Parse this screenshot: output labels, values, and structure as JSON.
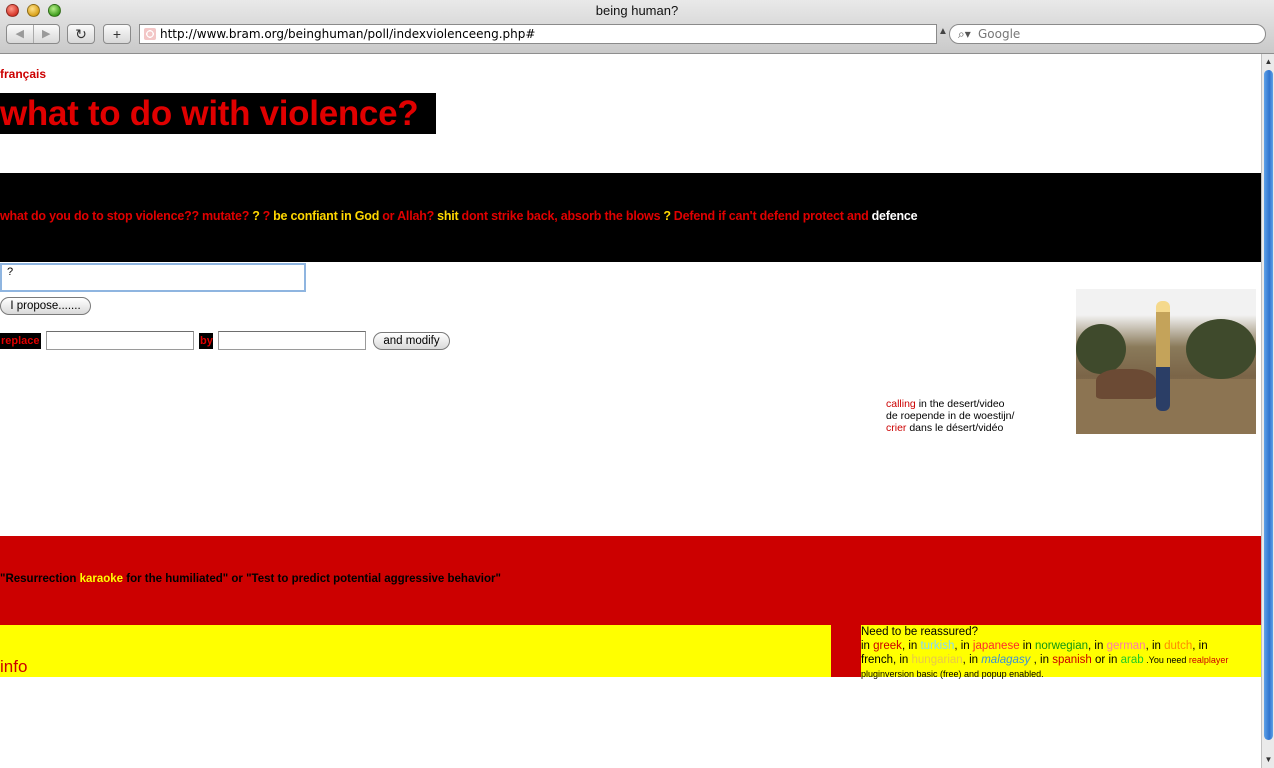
{
  "browser": {
    "title": "being human?",
    "url": "http://www.bram.org/beinghuman/poll/indexviolenceeng.php#",
    "search_placeholder": "Google"
  },
  "page": {
    "language_link": "français",
    "headline": "what to do with violence?",
    "answers": [
      {
        "text": "what do you do to stop violence??",
        "color": "#e00000"
      },
      {
        "text": "mutate?",
        "color": "#e00000"
      },
      {
        "text": "?",
        "color": "#ffd700"
      },
      {
        "text": "?",
        "color": "#e00000"
      },
      {
        "text": "be confiant in God",
        "color": "#ffd700"
      },
      {
        "text": "or Allah?",
        "color": "#e00000"
      },
      {
        "text": "shit",
        "color": "#ffd700"
      },
      {
        "text": "dont strike back, absorb the blows",
        "color": "#e00000"
      },
      {
        "text": "?",
        "color": "#ffd700"
      },
      {
        "text": "Defend if can't defend protect and",
        "color": "#e00000"
      },
      {
        "text": "defence",
        "color": "#ffffff"
      }
    ],
    "propose_input_value": "?",
    "propose_button": "I propose.......",
    "replace_label": "replace",
    "by_label": "by",
    "modify_button": "and modify",
    "video": {
      "line1_link": "calling",
      "line1_rest": " in the desert/video",
      "line2": "de roepende in de woestijn/",
      "line3_link": "crier",
      "line3_rest": " dans le désert/vidéo"
    },
    "banner": {
      "part1": "\"Resurrection ",
      "karaoke": "karaoke",
      "part2": " for the humiliated\" or \"Test to predict potential aggressive behavior\""
    },
    "info_link": "info",
    "reassure": {
      "heading": "Need to be reassured?",
      "in": "in ",
      "greek": "greek",
      "turkish": "turkish",
      "japanese": "japanese",
      "norwegian": "norwegian",
      "german": "german",
      "dutch": "dutch",
      "french": "french",
      "hungarian": "hungarian",
      "malagasy": "malagasy",
      "spanish": "spanish",
      "arab": "arab",
      "need_text": " .You need ",
      "realplayer": "realplayer",
      "plugin_text": "pluginversion basic (free) and popup enabled."
    }
  },
  "colors": {
    "red": "#cc0000",
    "yellow": "#ffff00",
    "black": "#000000"
  }
}
